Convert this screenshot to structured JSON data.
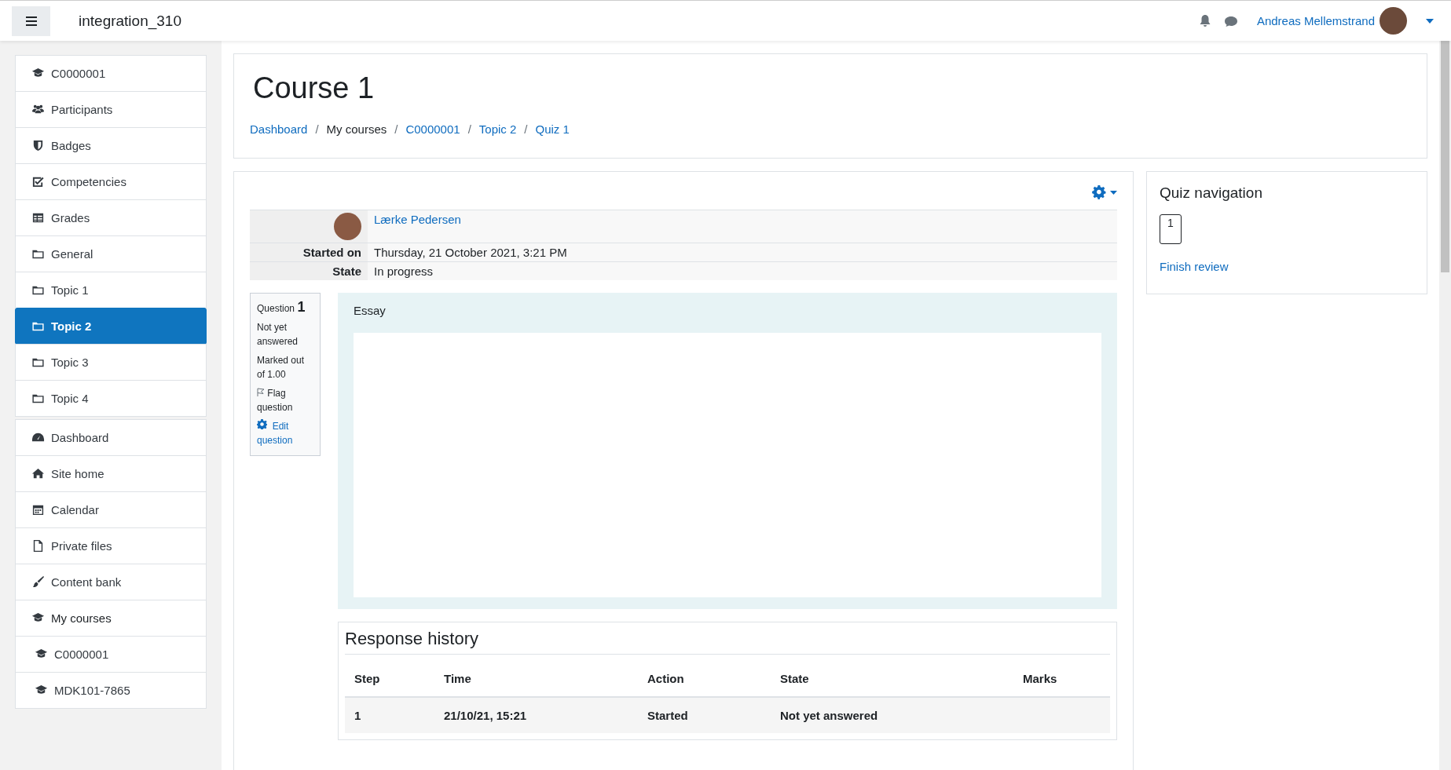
{
  "navbar": {
    "site_name": "integration_310",
    "user_name": "Andreas Mellemstrand"
  },
  "sidebar": {
    "groups": [
      {
        "items": [
          {
            "label": "C0000001",
            "selected": false
          },
          {
            "label": "Participants",
            "selected": false
          },
          {
            "label": "Badges",
            "selected": false
          },
          {
            "label": "Competencies",
            "selected": false
          },
          {
            "label": "Grades",
            "selected": false
          },
          {
            "label": "General",
            "selected": false
          },
          {
            "label": "Topic 1",
            "selected": false
          },
          {
            "label": "Topic 2",
            "selected": true
          },
          {
            "label": "Topic 3",
            "selected": false
          },
          {
            "label": "Topic 4",
            "selected": false
          }
        ]
      },
      {
        "items": [
          {
            "label": "Dashboard",
            "selected": false
          },
          {
            "label": "Site home",
            "selected": false
          },
          {
            "label": "Calendar",
            "selected": false
          },
          {
            "label": "Private files",
            "selected": false
          },
          {
            "label": "Content bank",
            "selected": false
          },
          {
            "label": "My courses",
            "selected": false,
            "children": [
              {
                "label": "C0000001",
                "selected": false
              },
              {
                "label": "MDK101-7865",
                "selected": false
              }
            ]
          }
        ]
      }
    ]
  },
  "header": {
    "title": "Course 1",
    "breadcrumb": [
      {
        "kind": "link",
        "label": "Dashboard"
      },
      {
        "kind": "separator",
        "label": "/"
      },
      {
        "kind": "text",
        "label": "My courses"
      },
      {
        "kind": "separator",
        "label": "/"
      },
      {
        "kind": "link",
        "label": "C0000001"
      },
      {
        "kind": "separator",
        "label": "/"
      },
      {
        "kind": "link",
        "label": "Topic 2"
      },
      {
        "kind": "separator",
        "label": "/"
      },
      {
        "kind": "link",
        "label": "Quiz 1"
      }
    ]
  },
  "attempt_summary": {
    "user_name": "Lærke Pedersen",
    "rows": [
      {
        "label": "Started on",
        "value": "Thursday, 21 October 2021, 3:21 PM"
      },
      {
        "label": "State",
        "value": "In progress"
      }
    ]
  },
  "question": {
    "label": "Question",
    "number": "1",
    "status": "Not yet answered",
    "marks": "Marked out of 1.00",
    "flag": "Flag question",
    "edit": "Edit question",
    "text": "Essay"
  },
  "response_history": {
    "title": "Response history",
    "columns": [
      "Step",
      "Time",
      "Action",
      "State",
      "Marks"
    ],
    "rows": [
      [
        "1",
        "21/10/21, 15:21",
        "Started",
        "Not yet answered",
        ""
      ]
    ]
  },
  "quiz_navigation": {
    "title": "Quiz navigation",
    "buttons": [
      {
        "label": "1"
      }
    ],
    "finish": "Finish review"
  }
}
